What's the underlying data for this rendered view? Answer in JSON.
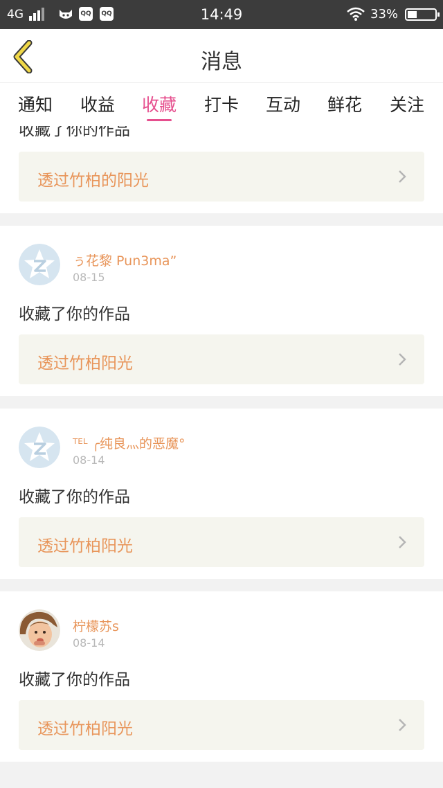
{
  "status_bar": {
    "network": "4G",
    "apps": [
      "QQ",
      "QQ"
    ],
    "time": "14:49",
    "battery": "33%",
    "battery_level": 0.33
  },
  "header": {
    "title": "消息",
    "back_icon": "chevron-left-icon",
    "accent": "#f0d848"
  },
  "tabs": [
    {
      "label": "通知"
    },
    {
      "label": "收益"
    },
    {
      "label": "收藏",
      "active": true
    },
    {
      "label": "打卡"
    },
    {
      "label": "互动"
    },
    {
      "label": "鲜花"
    },
    {
      "label": "关注"
    }
  ],
  "colors": {
    "accent_pink": "#e64f8e",
    "username_orange": "#e8955a",
    "work_bg": "#f5f5ee"
  },
  "feed": {
    "partial": {
      "action": "收藏了你的作品",
      "work_title": "透过竹柏的阳光"
    },
    "items": [
      {
        "username": "ぅ花黎 Pun3ma”",
        "date": "08-15",
        "action": "收藏了你的作品",
        "work_title": "透过竹柏阳光",
        "avatar": "qzone-default-avatar"
      },
      {
        "username": "ᵀᴱᴸ ╭纯良灬的恶魔°",
        "date": "08-14",
        "action": "收藏了你的作品",
        "work_title": "透过竹柏阳光",
        "avatar": "qzone-default-avatar"
      },
      {
        "username": "柠檬苏s",
        "date": "08-14",
        "action": "收藏了你的作品",
        "work_title": "透过竹柏阳光",
        "avatar": "child-photo-avatar"
      }
    ]
  }
}
